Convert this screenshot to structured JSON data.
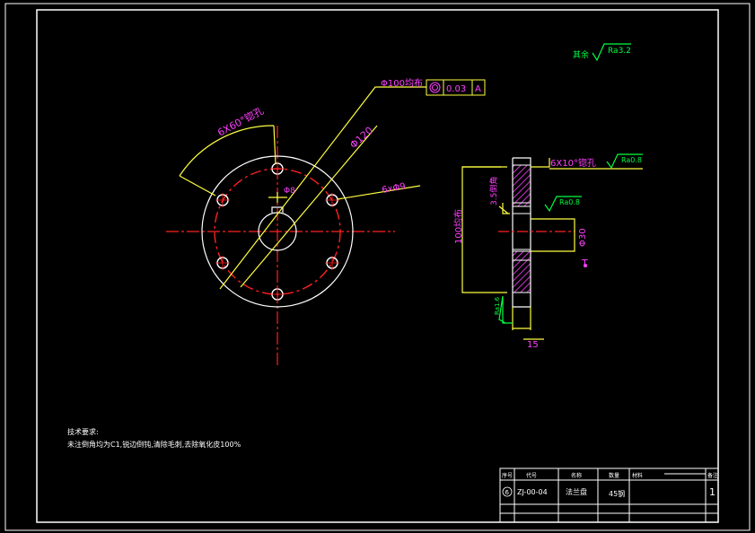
{
  "dimensions": {
    "chamfer_holes": "6X60°锪孔",
    "bolt_circle": "Φ100均布",
    "tolerance_value": "0.03",
    "datum": "A",
    "outer_diameter": "Φ120",
    "holes": "6xΦ9",
    "hub": "Φ8",
    "counterbore": "6X10°锪孔",
    "height_100": "100均布",
    "step": "3.5倒角",
    "bore": "Φ30",
    "thickness": "15",
    "datum_mark": "T"
  },
  "roughness": {
    "general": "Ra3.2",
    "face": "Ra0.8",
    "bore": "Ra0.8",
    "side": "Ra1.6",
    "general_prefix": "其余"
  },
  "notes": {
    "title": "技术要求:",
    "line1": "未注倒角均为C1,锐边倒钝,清除毛刺,去除氧化皮100%"
  },
  "title_block": {
    "headers": [
      "序号",
      "代号",
      "名称",
      "数量",
      "材料",
      "单件",
      "总计",
      "备注"
    ],
    "row_index": "6",
    "code": "ZJ-00-04",
    "name": "法兰盘",
    "material": "45钢",
    "qty": "1"
  }
}
